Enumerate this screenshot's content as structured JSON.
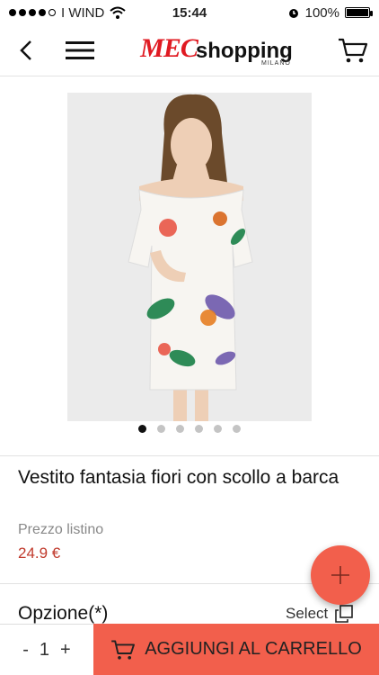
{
  "status_bar": {
    "carrier": "I WIND",
    "time": "15:44",
    "battery": "100%"
  },
  "header": {
    "logo_mark": "MEC",
    "logo_text": "shopping",
    "logo_sub": "MILANO"
  },
  "product": {
    "title": "Vestito fantasia fiori con scollo a barca",
    "price_label": "Prezzo listino",
    "price": "24.9 €",
    "image_count": 6,
    "active_image": 1
  },
  "options": {
    "label": "Opzione(*)",
    "select_label": "Select"
  },
  "bottom_bar": {
    "qty_minus": "-",
    "qty_value": "1",
    "qty_plus": "+",
    "add_to_cart_label": "AGGIUNGI AL CARRELLO"
  },
  "icons": {
    "back": "chevron-left-icon",
    "menu": "hamburger-icon",
    "cart": "cart-icon",
    "add": "plus-icon",
    "select": "copy-icon"
  },
  "colors": {
    "accent": "#f25f4c",
    "price": "#c0392b",
    "brand_red": "#e01a22"
  }
}
